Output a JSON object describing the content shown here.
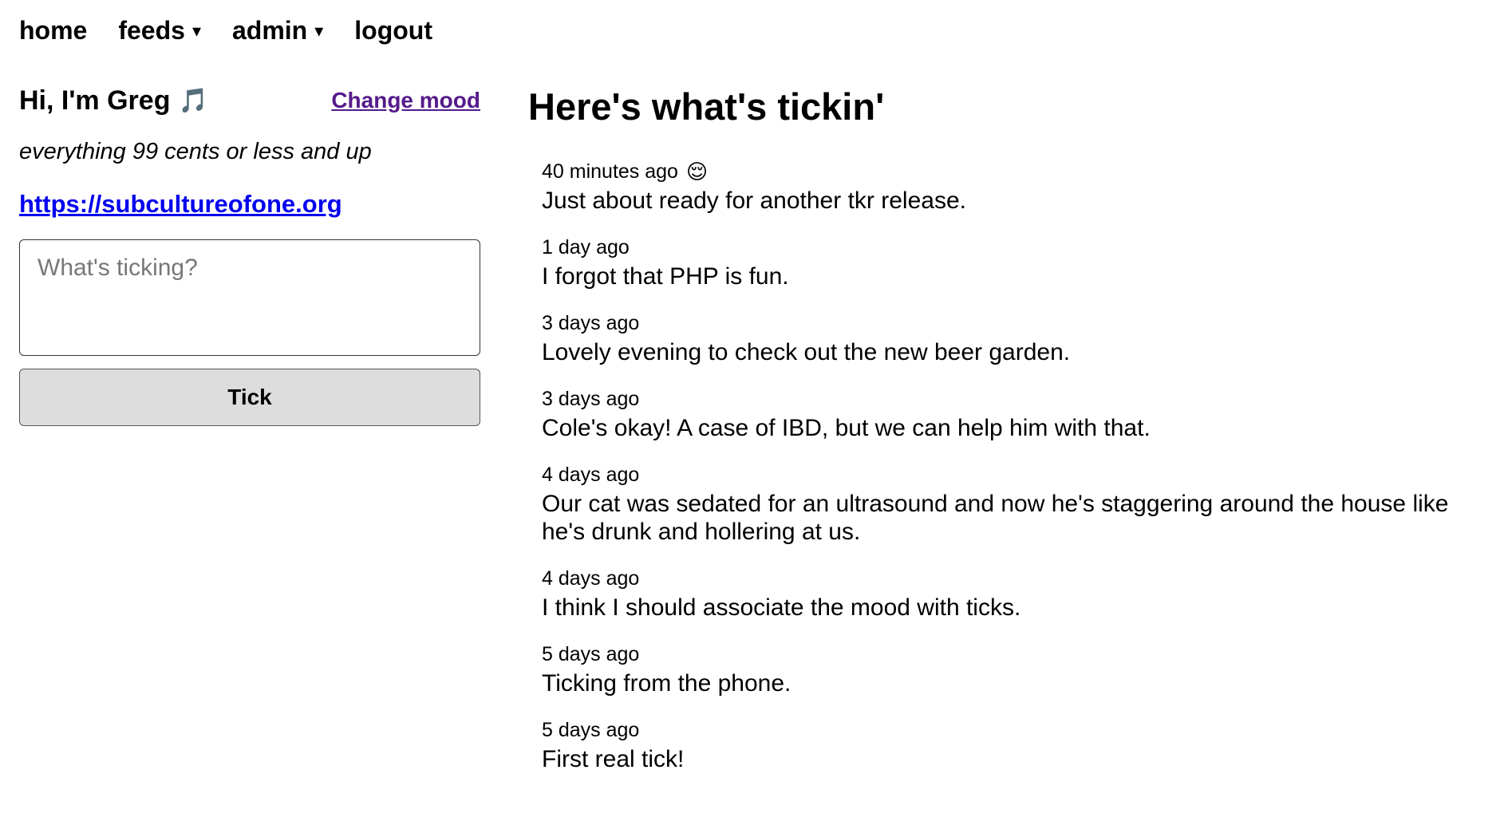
{
  "nav": {
    "home": "home",
    "feeds": "feeds",
    "admin": "admin",
    "logout": "logout",
    "caret": "▾"
  },
  "profile": {
    "greeting": "Hi, I'm Greg",
    "mood_emoji": "🎵",
    "change_mood": "Change mood",
    "tagline": "everything 99 cents or less and up",
    "url": "https://subcultureofone.org"
  },
  "composer": {
    "placeholder": "What's ticking?",
    "value": "",
    "button": "Tick"
  },
  "feed": {
    "title": "Here's what's tickin'",
    "ticks": [
      {
        "time": "40 minutes ago",
        "mood": "😌",
        "text": "Just about ready for another tkr release."
      },
      {
        "time": "1 day ago",
        "mood": "",
        "text": "I forgot that PHP is fun."
      },
      {
        "time": "3 days ago",
        "mood": "",
        "text": "Lovely evening to check out the new beer garden."
      },
      {
        "time": "3 days ago",
        "mood": "",
        "text": "Cole's okay! A case of IBD, but we can help him with that."
      },
      {
        "time": "4 days ago",
        "mood": "",
        "text": "Our cat was sedated for an ultrasound and now he's staggering around the house like he's drunk and hollering at us."
      },
      {
        "time": "4 days ago",
        "mood": "",
        "text": "I think I should associate the mood with ticks."
      },
      {
        "time": "5 days ago",
        "mood": "",
        "text": "Ticking from the phone."
      },
      {
        "time": "5 days ago",
        "mood": "",
        "text": "First real tick!"
      }
    ]
  }
}
